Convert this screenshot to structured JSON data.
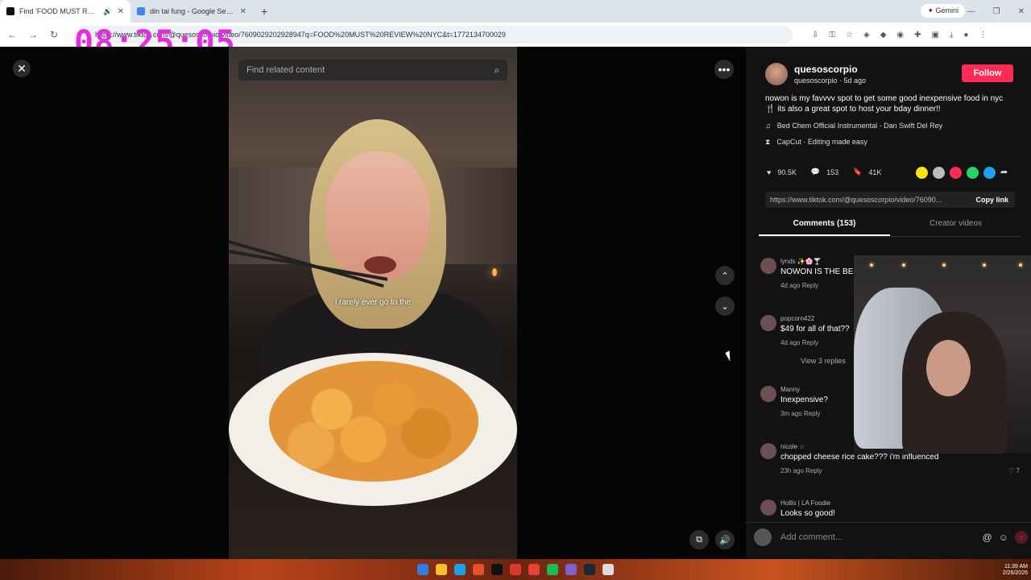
{
  "browser": {
    "tabs": [
      {
        "title": "Find 'FOOD MUST REVIEW",
        "active": true
      },
      {
        "title": "din tai fung - Google Search",
        "active": false
      }
    ],
    "new_tab": "+",
    "gemini": "Gemini",
    "url": "https://www.tiktok.com/@quesoscorpio/video/7609029202928947q=FOOD%20MUST%20REVIEW%20NYC&t=1772134700029"
  },
  "overlay_timer": "08:25:05",
  "video": {
    "search_placeholder": "Find related content",
    "caption": "i rarely ever go to the"
  },
  "sidebar": {
    "username": "quesoscorpio",
    "handle_line": "quesoscorpio · 5d ago",
    "follow_label": "Follow",
    "description": "nowon is my favvvv spot to get some good inexpensive food in nyc 🍴 its also a great spot to host your bday dinner!!",
    "music": "Bed Chem Official Instrumental - Dan Swift Del Rey",
    "capcut": "CapCut · Editing made easy",
    "likes": "90.5K",
    "comments_count": "153",
    "saves": "41K",
    "share_colors": [
      "#f5e50a",
      "#bdbdbd",
      "#fe2c55",
      "#25d366",
      "#1da1f2"
    ],
    "link": "https://www.tiktok.com/@quesoscorpio/video/76090...",
    "copy_link": "Copy link",
    "tab_comments": "Comments (153)",
    "tab_creator": "Creator videos",
    "comments": [
      {
        "user": "lynds ✨🌸🍸",
        "text": "NOWON IS THE BES",
        "meta": "4d ago   Reply",
        "likes": ""
      },
      {
        "user": "popcorn422",
        "text": "$49 for all of that??",
        "meta": "4d ago   Reply",
        "likes": ""
      },
      {
        "user": "Manny",
        "text": "Inexpensive?",
        "meta": "3m ago   Reply",
        "likes": ""
      },
      {
        "user": "nicole ☆",
        "text": "chopped cheese rice cake??? i'm influenced",
        "meta": "23h ago   Reply",
        "likes": "♡ 7"
      },
      {
        "user": "Hollis | LA Foodie",
        "text": "Looks so good!",
        "meta": "",
        "likes": ""
      }
    ],
    "view_replies": "View 3 replies",
    "add_comment_placeholder": "Add comment..."
  },
  "taskbar": {
    "time": "11:39 AM",
    "date": "2/26/2026",
    "icon_colors": [
      "#2f7de1",
      "#f3c12f",
      "#1aa1e6",
      "#e3502b",
      "#111111",
      "#d63b2f",
      "#e94235",
      "#1db954",
      "#7b61d1",
      "#1b2838",
      "#dddddd"
    ]
  }
}
